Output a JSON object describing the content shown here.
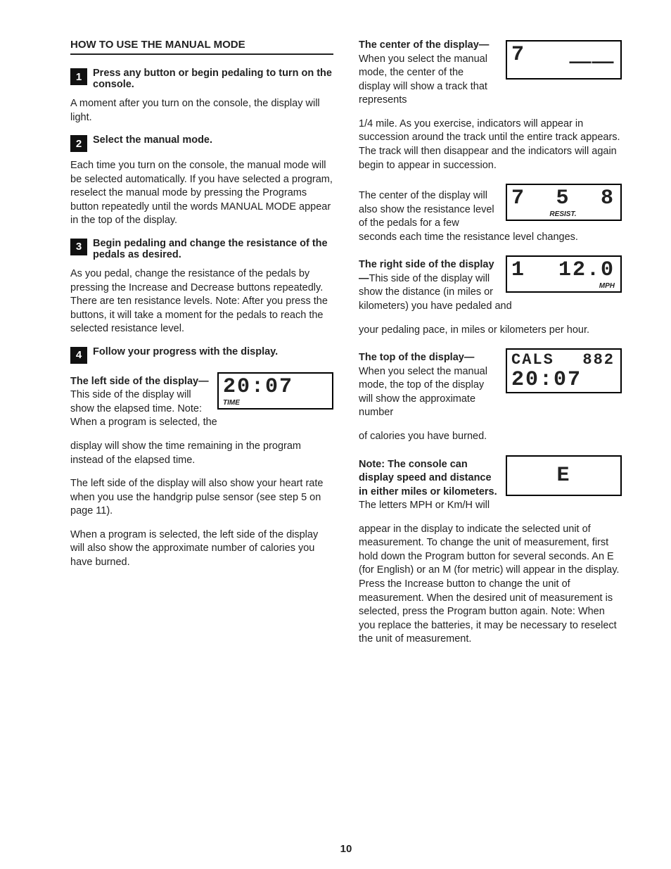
{
  "header": "HOW TO USE THE MANUAL MODE",
  "page_number": "10",
  "steps": [
    {
      "num": "1",
      "title": "Press any button or begin pedaling to turn on the console.",
      "p1": "A moment after you turn on the console, the display will light."
    },
    {
      "num": "2",
      "title": "Select the manual mode.",
      "p1": "Each time you turn on the console, the manual mode will be selected automatically. If you have selected a program, reselect the manual mode by pressing the Programs button repeatedly until the words MANUAL MODE appear in the top of the display."
    },
    {
      "num": "3",
      "title": "Begin pedaling and change the resistance of the pedals as desired.",
      "p1": "As you pedal, change the resistance of the pedals by pressing the Increase and Decrease buttons repeatedly. There are ten resistance levels. Note: After you press the buttons, it will take a moment for the pedals to reach the selected resistance level."
    },
    {
      "num": "4",
      "title": "Follow your progress with the display."
    }
  ],
  "left": {
    "block1_lead": "The left side of the display—",
    "block1_body": "This side of the display will show the elapsed time. Note: When a program is selected, the",
    "block1_after": "display will show the time remaining in the program instead of the elapsed time.",
    "p2": "The left side of the display will also show your heart rate when you use the handgrip pulse sensor (see step 5 on page 11).",
    "p3": "When a program is selected, the left side of the display will also show the approximate number of calories you have burned.",
    "fig": {
      "value": "20:07",
      "label": "TIME"
    }
  },
  "right": {
    "center_lead": "The center of the display—",
    "center_body": "When you select the manual mode, the center of the display will show a track that represents",
    "center_after": "1/4 mile. As you exercise, indicators will appear in succession around the track until the entire track appears. The track will then disappear and the indicators will again begin to appear in succession.",
    "center_fig": {
      "left": "7",
      "right": "⸏⸏"
    },
    "resist_body": "The center of the display will also show the resistance level of the pedals for a few seconds each time the resistance level changes.",
    "resist_fig": {
      "left": "7",
      "mid": "5",
      "right": "8",
      "label": "RESIST."
    },
    "rightside_lead": "The right side of the display—",
    "rightside_body": "This side of the display will show the distance (in miles or kilometers) you have pedaled and",
    "rightside_after": "your pedaling pace, in miles or kilometers per hour.",
    "rightside_fig": {
      "left": "1",
      "right": "12.0",
      "label": "MPH"
    },
    "top_lead": "The top of the display—",
    "top_body": "When you select the manual mode, the top of the display will show the approximate number",
    "top_after": "of calories you have burned.",
    "top_fig": {
      "line1_left": "CALS",
      "line1_right": "882",
      "line2": "20:07"
    },
    "note_lead": "Note: The console can display speed and distance in either miles or kilometers.",
    "note_body": " The letters MPH or Km/H will",
    "note_after": "appear in the display to indicate the selected unit of measurement. To change the unit of measurement, first hold down the Program button for several seconds. An E (for English) or an M (for metric) will appear in the display. Press the Increase button to change the unit of measurement. When the desired unit of measurement is selected, press the Program button again. Note: When you replace the batteries, it may be necessary to reselect the unit of measurement.",
    "note_fig": {
      "value": "E"
    }
  }
}
